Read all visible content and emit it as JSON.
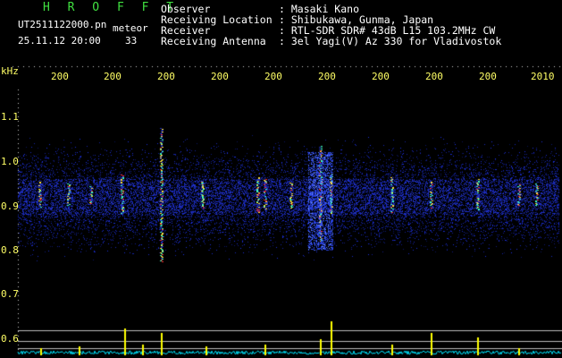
{
  "header": {
    "app_title": "H R O F F T",
    "app_title_color": "#40e040",
    "filename": "UT2511122000.pn",
    "mode": "meteor",
    "datetime": "25.11.12 20:00",
    "count": "33",
    "info_rows": [
      {
        "label": "Observer",
        "value": ": Masaki Kano"
      },
      {
        "label": "Receiving Location",
        "value": ": Shibukawa, Gunma, Japan"
      },
      {
        "label": "Receiver",
        "value": ": RTL-SDR SDR# 43dB L15 103.2MHz CW"
      },
      {
        "label": "Receiving Antenna",
        "value": ": 3el Yagi(V) Az 330 for Vladivostok"
      }
    ]
  },
  "axis": {
    "y_unit": "kHz",
    "y_ticks": [
      "1.1",
      "1.0",
      "0.9",
      "0.8",
      "0.7",
      "0.6"
    ],
    "x_ticks": [
      "200",
      "200",
      "200",
      "200",
      "200",
      "200",
      "200",
      "200",
      "200",
      "2010"
    ],
    "label_color": "#ffff66"
  },
  "colors": {
    "background": "#000000",
    "noise": "#2030c0",
    "signal_hot": "#ff3030",
    "signal_warm": "#ffe040",
    "signal_cool": "#40ffc0",
    "baseline": "#00e5ff",
    "spike": "#ffff00"
  }
}
